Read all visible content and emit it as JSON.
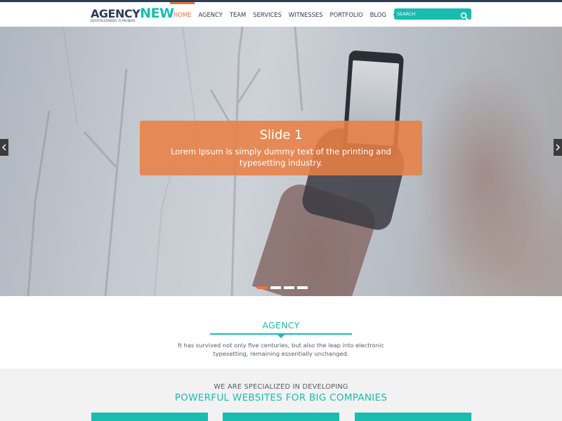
{
  "brand": {
    "name_part1": "AGENCY",
    "name_part2": "NEW",
    "tagline": "DIGITALIZANDO O MUNDO",
    "colors": {
      "dark": "#2c3e50",
      "teal": "#1bbcb0",
      "orange": "#e8733a"
    }
  },
  "nav": {
    "items": [
      {
        "label": "HOME",
        "active": true
      },
      {
        "label": "AGENCY"
      },
      {
        "label": "TEAM"
      },
      {
        "label": "SERVICES"
      },
      {
        "label": "WITNESSES"
      },
      {
        "label": "PORTFOLIO"
      },
      {
        "label": "BLOG"
      },
      {
        "label": "CONTACT"
      }
    ]
  },
  "search": {
    "placeholder": "SEARCH",
    "icon": "search-icon"
  },
  "slider": {
    "title": "Slide 1",
    "text": "Lorem Ipsum is simply dummy text of the printing and typesetting industry.",
    "prev_icon": "chevron-left-icon",
    "next_icon": "chevron-right-icon",
    "active_slide": 1,
    "slide_count": 4
  },
  "agency": {
    "title": "AGENCY",
    "text": "It has survived not only five centuries, but also the leap into electronic typesetting, remaining essentially unchanged."
  },
  "specialized": {
    "subtitle": "WE ARE SPECIALIZED IN DEVELOPING",
    "title": "POWERFUL WEBSITES FOR BIG COMPANIES"
  }
}
